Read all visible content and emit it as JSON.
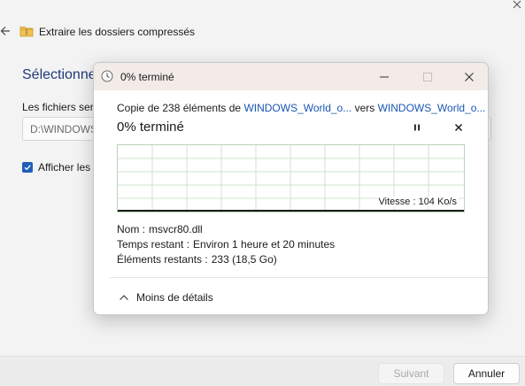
{
  "wizard": {
    "title": "Extraire les dossiers compressés",
    "heading": "Sélectionne",
    "dest_label": "Les fichiers sero",
    "path_value": "D:\\WINDOWS",
    "show_checkbox_label": "Afficher les",
    "next_label": "Suivant",
    "cancel_label": "Annuler"
  },
  "dialog": {
    "title": "0% terminé",
    "copy_prefix": "Copie de 238 éléments de ",
    "copy_source": "WINDOWS_World_o...",
    "copy_mid": " vers ",
    "copy_dest": "WINDOWS_World_o...",
    "percent": "0% terminé",
    "speed": "Vitesse : 104 Ko/s",
    "details": [
      {
        "key": "Nom :",
        "value": "msvcr80.dll"
      },
      {
        "key": "Temps restant :",
        "value": "Environ 1 heure et 20 minutes"
      },
      {
        "key": "Éléments restants :",
        "value": "233 (18,5 Go)"
      }
    ],
    "less_details_label": "Moins de détails"
  },
  "colors": {
    "accent": "#1f5fb8",
    "link": "#1a56b0",
    "heading": "#1f3a7a",
    "titlebar": "#f2ebe8",
    "graph_grid": "#b9d4b9"
  },
  "icons": {
    "wizard_close": "close-icon",
    "wizard_back": "back-arrow-icon",
    "folder": "zip-folder-icon",
    "clock": "clock-icon",
    "pause": "pause-icon",
    "cancel": "close-icon",
    "chevron": "chevron-up-icon"
  }
}
